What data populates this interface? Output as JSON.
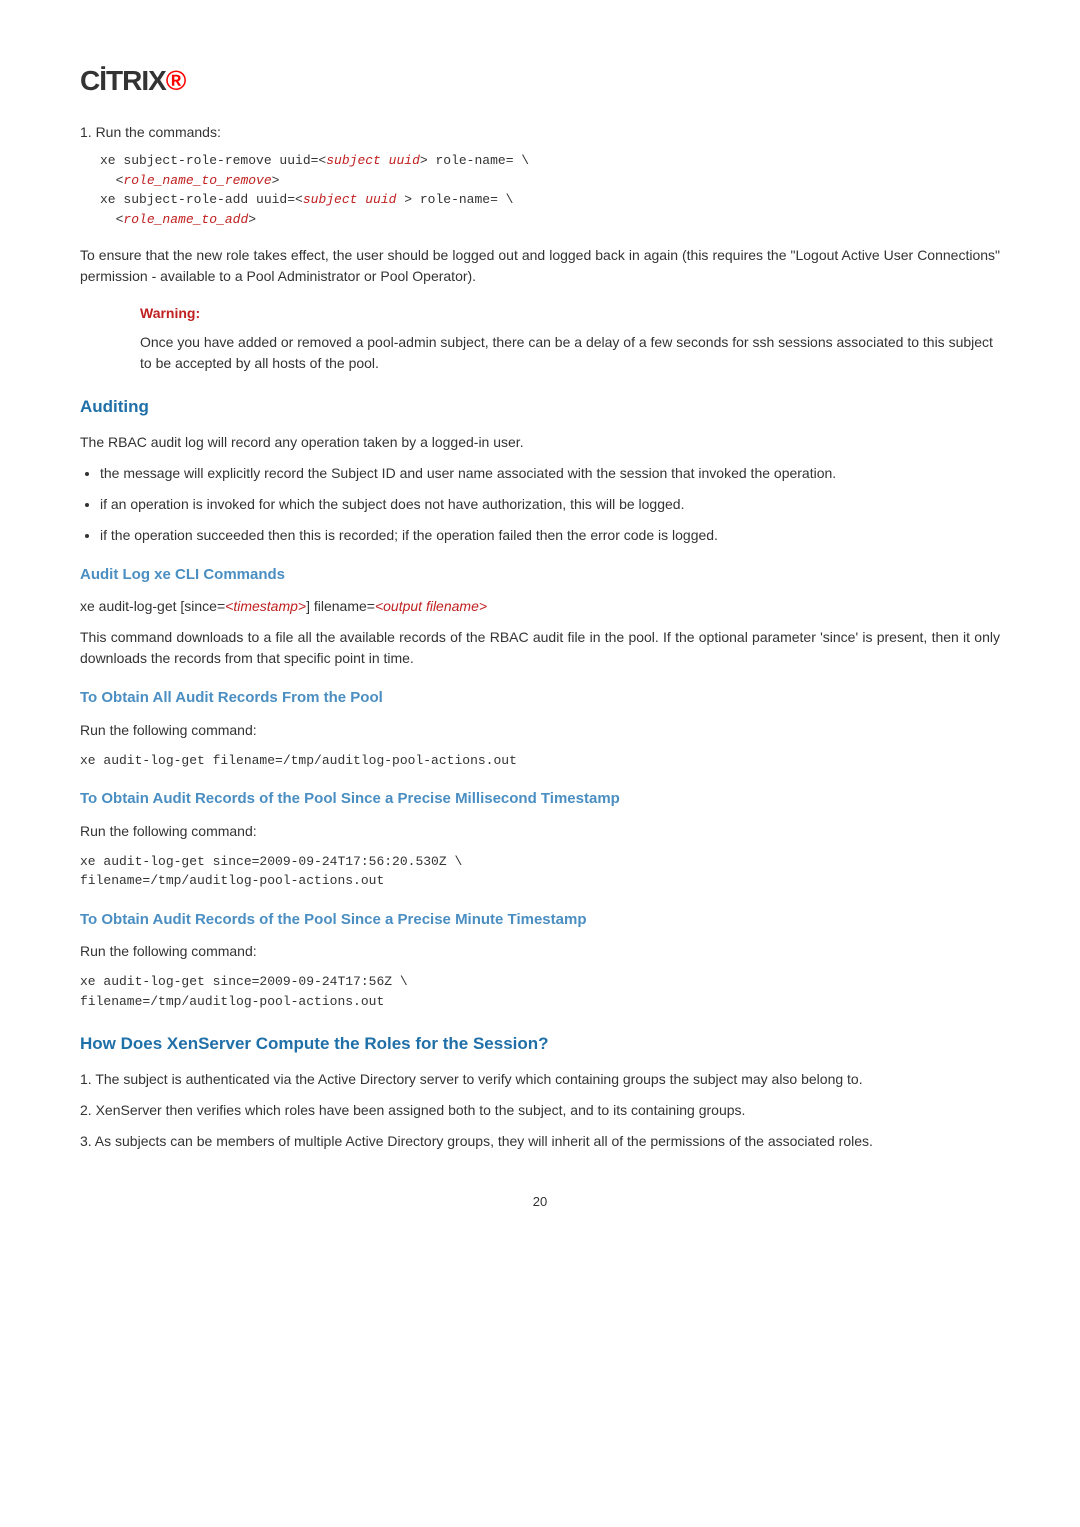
{
  "logo": "CİTRIX",
  "step1_label": "1. Run the commands:",
  "code1_line1a": "xe subject-role-remove uuid=<",
  "code1_line1b": "subject uuid",
  "code1_line1c": "> role-name= \\",
  "code1_line2a": "  <",
  "code1_line2b": "role_name_to_remove",
  "code1_line2c": ">",
  "code1_line3a": "xe subject-role-add uuid=<",
  "code1_line3b": "subject uuid ",
  "code1_line3c": "> role-name= \\",
  "code1_line4a": "  <",
  "code1_line4b": "role_name_to_add",
  "code1_line4c": ">",
  "para1": "To ensure that the new role takes effect, the user should be logged out and logged back in again (this requires the \"Logout Active User Connections\" permission - available to a Pool Administrator or Pool Operator).",
  "warning_title": "Warning:",
  "warning_text": "Once you have added or removed a pool-admin subject, there can be a delay of a few seconds for ssh sessions associated to this subject to be accepted by all hosts of the pool.",
  "h2_auditing": "Auditing",
  "para2": "The RBAC audit log will record any operation taken by a logged-in user.",
  "bullet1": "the message will explicitly record the Subject ID and user name associated with the session that invoked the operation.",
  "bullet2": "if an operation is invoked for which the subject does not have authorization, this will be logged.",
  "bullet3": "if the operation succeeded then this is recorded; if the operation failed then the error code is logged.",
  "h3_auditlog": "Audit Log xe CLI Commands",
  "cmdline_a": "xe audit-log-get [since=",
  "cmdline_b": "<timestamp>",
  "cmdline_c": "] filename=",
  "cmdline_d": "<output filename>",
  "para3": "This command downloads to a file all the available records of the RBAC audit file in the pool. If the optional parameter 'since' is present, then it only downloads the records from that specific point in time.",
  "h3_obtainall": "To Obtain All Audit Records From the Pool",
  "run_cmd": "Run the following command:",
  "mono1": "xe audit-log-get filename=/tmp/auditlog-pool-actions.out",
  "h3_obtainms": "To Obtain Audit Records of the Pool Since a Precise Millisecond Timestamp",
  "mono2": "xe audit-log-get since=2009-09-24T17:56:20.530Z \\\nfilename=/tmp/auditlog-pool-actions.out",
  "h3_obtainmin": "To Obtain Audit Records of the Pool Since a Precise Minute Timestamp",
  "mono3": "xe audit-log-get since=2009-09-24T17:56Z \\\nfilename=/tmp/auditlog-pool-actions.out",
  "h2_howdoes": "How Does XenServer Compute the Roles for the Session?",
  "para4": "1. The subject is authenticated via the Active Directory server to verify which containing groups the subject may also belong to.",
  "para5": "2. XenServer then verifies which roles have been assigned both to the subject, and to its containing groups.",
  "para6": "3. As subjects can be members of multiple Active Directory groups, they will inherit all of the permissions of the associated roles.",
  "page_num": "20"
}
